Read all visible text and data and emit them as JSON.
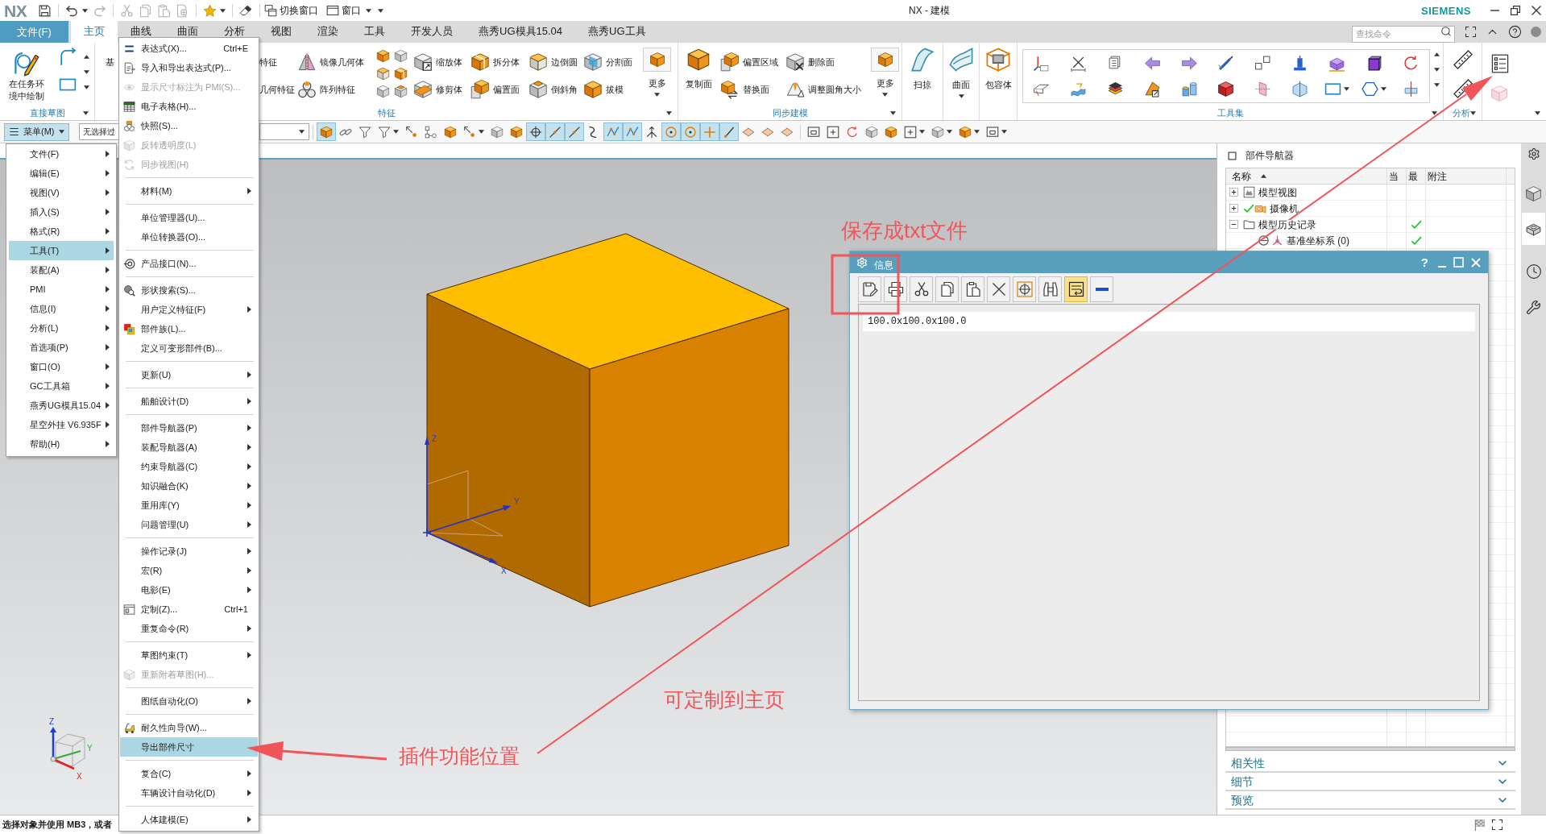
{
  "title_bar": {
    "logo": "NX",
    "quick_access": [
      [
        {
          "kind": "save",
          "disabled": false,
          "dropdown": false
        }
      ],
      [
        {
          "kind": "undo",
          "disabled": false,
          "dropdown": true
        },
        {
          "kind": "redo",
          "disabled": true,
          "dropdown": false
        }
      ],
      [
        {
          "kind": "cut",
          "disabled": true,
          "dropdown": false
        },
        {
          "kind": "copy",
          "disabled": true,
          "dropdown": false
        },
        {
          "kind": "paste",
          "disabled": true,
          "dropdown": false
        },
        {
          "kind": "document",
          "disabled": true,
          "dropdown": false
        }
      ],
      [
        {
          "kind": "star",
          "disabled": false,
          "dropdown": true
        }
      ],
      [
        {
          "kind": "eraser",
          "disabled": false,
          "dropdown": false
        }
      ]
    ],
    "switch_window": "切换窗口",
    "window_menu": "窗口",
    "title": "NX - 建模",
    "brand": "SIEMENS"
  },
  "ribbon_tabs": {
    "file": "文件(F)",
    "tabs": [
      {
        "label": "主页",
        "selected": true
      },
      {
        "label": "曲线",
        "selected": false
      },
      {
        "label": "曲面",
        "selected": false
      },
      {
        "label": "分析",
        "selected": false
      },
      {
        "label": "视图",
        "selected": false
      },
      {
        "label": "渲染",
        "selected": false
      },
      {
        "label": "工具",
        "selected": false
      },
      {
        "label": "开发人员",
        "selected": false
      },
      {
        "label": "燕秀UG模具15.04",
        "selected": false
      },
      {
        "label": "燕秀UG工具",
        "selected": false
      }
    ],
    "search": {
      "placeholder": "查找命令"
    }
  },
  "ribbon": {
    "sketch": {
      "label": "直接草图",
      "button": "在任务环境中绘制"
    },
    "features": {
      "label": "特征",
      "hidden_left": "基",
      "cut_labels": [
        "特征",
        "几何特征"
      ],
      "columns": [
        [
          {
            "label": "镜像几何体",
            "kind": "mirror"
          },
          {
            "label": "阵列特征",
            "kind": "pattern"
          }
        ],
        [
          {
            "label": "缩放体",
            "kind": "scale"
          },
          {
            "label": "修剪体",
            "kind": "trim"
          }
        ],
        [
          {
            "label": "拆分体",
            "kind": "split"
          },
          {
            "label": "偏置面",
            "kind": "offset"
          }
        ],
        [
          {
            "label": "边倒圆",
            "kind": "blend"
          },
          {
            "label": "倒斜角",
            "kind": "chamfer"
          }
        ],
        [
          {
            "label": "分割面",
            "kind": "divide"
          },
          {
            "label": "拔模",
            "kind": "draft"
          }
        ]
      ],
      "more": "更多"
    },
    "sync": {
      "label": "同步建模",
      "large": "复制面",
      "columns": [
        [
          {
            "label": "偏置区域",
            "kind": "offset_region"
          },
          {
            "label": "替换面",
            "kind": "replace"
          }
        ],
        [
          {
            "label": "删除面",
            "kind": "delete_face"
          },
          {
            "label": "调整圆角大小",
            "kind": "resize"
          }
        ]
      ],
      "more": "更多"
    },
    "large_buttons": [
      {
        "label": "扫掠",
        "kind": "sweep",
        "dropdown": false
      },
      {
        "label": "曲面",
        "kind": "surface",
        "dropdown": true
      },
      {
        "label": "包容体",
        "kind": "envelope",
        "dropdown": false
      }
    ],
    "toolset": {
      "label": "工具集"
    },
    "analysis": {
      "label": "分析"
    }
  },
  "toolbar": {
    "menu_button": {
      "label": "菜单(M)",
      "open": true
    },
    "filter": {
      "value": "无选择过"
    },
    "tools": [
      [
        {
          "kind": "body",
          "selected": true,
          "dropdown": false
        },
        {
          "kind": "link",
          "selected": false,
          "dropdown": false
        },
        {
          "kind": "funnel",
          "selected": false,
          "dropdown": false
        },
        {
          "kind": "funnel",
          "selected": false,
          "dropdown": true
        },
        {
          "kind": "point",
          "selected": false,
          "dropdown": false
        },
        {
          "kind": "nodes",
          "selected": false,
          "dropdown": false
        },
        {
          "kind": "body",
          "selected": false,
          "dropdown": false
        },
        {
          "kind": "point",
          "selected": false,
          "dropdown": true
        },
        {
          "kind": "shade",
          "selected": false,
          "dropdown": false
        },
        {
          "kind": "body",
          "selected": false,
          "dropdown": false
        },
        {
          "kind": "target",
          "selected": true,
          "dropdown": false
        },
        {
          "kind": "line",
          "selected": true,
          "dropdown": false
        },
        {
          "kind": "line",
          "selected": true,
          "dropdown": false
        },
        {
          "kind": "curve",
          "selected": false,
          "dropdown": false
        },
        {
          "kind": "polyline",
          "selected": true,
          "dropdown": false
        },
        {
          "kind": "polyline",
          "selected": true,
          "dropdown": false
        },
        {
          "kind": "axis",
          "selected": false,
          "dropdown": false
        },
        {
          "kind": "ring",
          "selected": true,
          "dropdown": false
        },
        {
          "kind": "ring",
          "selected": true,
          "dropdown": false
        },
        {
          "kind": "plus",
          "selected": true,
          "dropdown": false
        },
        {
          "kind": "pen",
          "selected": true,
          "dropdown": false
        },
        {
          "kind": "face",
          "selected": false,
          "dropdown": false
        },
        {
          "kind": "face",
          "selected": false,
          "dropdown": false
        },
        {
          "kind": "face",
          "selected": false,
          "dropdown": false
        }
      ],
      [
        {
          "kind": "frame",
          "selected": false,
          "dropdown": false
        },
        {
          "kind": "fit",
          "selected": false,
          "dropdown": false
        },
        {
          "kind": "rotate",
          "selected": false,
          "dropdown": false
        },
        {
          "kind": "shade",
          "selected": false,
          "dropdown": false
        },
        {
          "kind": "body",
          "selected": false,
          "dropdown": false
        },
        {
          "kind": "fit",
          "selected": false,
          "dropdown": true
        },
        {
          "kind": "shade",
          "selected": false,
          "dropdown": true
        },
        {
          "kind": "body",
          "selected": false,
          "dropdown": true
        },
        {
          "kind": "frame",
          "selected": false,
          "dropdown": true
        }
      ]
    ]
  },
  "main_menu": [
    {
      "label": "文件(F)",
      "selected": false,
      "submenu": true
    },
    {
      "label": "编辑(E)",
      "selected": false,
      "submenu": true
    },
    {
      "label": "视图(V)",
      "selected": false,
      "submenu": true
    },
    {
      "label": "插入(S)",
      "selected": false,
      "submenu": true
    },
    {
      "label": "格式(R)",
      "selected": false,
      "submenu": true
    },
    {
      "label": "工具(T)",
      "selected": true,
      "submenu": true
    },
    {
      "label": "装配(A)",
      "selected": false,
      "submenu": true
    },
    {
      "label": "PMI",
      "selected": false,
      "submenu": true
    },
    {
      "label": "信息(I)",
      "selected": false,
      "submenu": true
    },
    {
      "label": "分析(L)",
      "selected": false,
      "submenu": true
    },
    {
      "label": "首选项(P)",
      "selected": false,
      "submenu": true
    },
    {
      "label": "窗口(O)",
      "selected": false,
      "submenu": true
    },
    {
      "label": "GC工具箱",
      "selected": false,
      "submenu": true
    },
    {
      "label": "燕秀UG模具15.04",
      "selected": false,
      "submenu": true
    },
    {
      "label": "星空外挂 V6.935F",
      "selected": false,
      "submenu": true
    },
    {
      "label": "帮助(H)",
      "selected": false,
      "submenu": true
    }
  ],
  "tools_menu": {
    "sections": [
      [
        {
          "label": "表达式(X)...",
          "shortcut": "Ctrl+E",
          "kind": "formula",
          "disabled": false,
          "selected": false,
          "submenu": false
        },
        {
          "label": "导入和导出表达式(P)...",
          "kind": "import",
          "disabled": false,
          "selected": false,
          "submenu": false
        },
        {
          "label": "显示尺寸标注为 PMI(S)...",
          "kind": "pmi",
          "disabled": true,
          "selected": false,
          "submenu": false
        },
        {
          "label": "电子表格(H)...",
          "kind": "sheet",
          "disabled": false,
          "selected": false,
          "submenu": false
        },
        {
          "label": "快照(S)...",
          "kind": "snapshot",
          "disabled": false,
          "selected": false,
          "submenu": false
        },
        {
          "label": "反转透明度(L)",
          "kind": "transparency",
          "disabled": true,
          "selected": false,
          "submenu": false
        },
        {
          "label": "同步视图(H)",
          "kind": "sync",
          "disabled": true,
          "selected": false,
          "submenu": false
        }
      ],
      [
        {
          "label": "材料(M)",
          "kind": "plain",
          "disabled": false,
          "selected": false,
          "submenu": true
        }
      ],
      [
        {
          "label": "单位管理器(U)...",
          "kind": "plain",
          "disabled": false,
          "selected": false,
          "submenu": false
        },
        {
          "label": "单位转换器(O)...",
          "kind": "plain",
          "disabled": false,
          "selected": false,
          "submenu": false
        }
      ],
      [
        {
          "label": "产品接口(N)...",
          "kind": "interface",
          "disabled": false,
          "selected": false,
          "submenu": false
        }
      ],
      [
        {
          "label": "形状搜索(S)...",
          "kind": "shape",
          "disabled": false,
          "selected": false,
          "submenu": false
        },
        {
          "label": "用户定义特征(F)",
          "kind": "plain",
          "disabled": false,
          "selected": false,
          "submenu": true
        },
        {
          "label": "部件族(L)...",
          "kind": "family",
          "disabled": false,
          "selected": false,
          "submenu": false
        },
        {
          "label": "定义可变形部件(B)...",
          "kind": "plain",
          "disabled": false,
          "selected": false,
          "submenu": false
        }
      ],
      [
        {
          "label": "更新(U)",
          "kind": "plain",
          "disabled": false,
          "selected": false,
          "submenu": true
        }
      ],
      [
        {
          "label": "船舶设计(D)",
          "kind": "plain",
          "disabled": false,
          "selected": false,
          "submenu": true
        }
      ],
      [
        {
          "label": "部件导航器(P)",
          "kind": "plain",
          "disabled": false,
          "selected": false,
          "submenu": true
        },
        {
          "label": "装配导航器(A)",
          "kind": "plain",
          "disabled": false,
          "selected": false,
          "submenu": true
        },
        {
          "label": "约束导航器(C)",
          "kind": "plain",
          "disabled": false,
          "selected": false,
          "submenu": true
        },
        {
          "label": "知识融合(K)",
          "kind": "plain",
          "disabled": false,
          "selected": false,
          "submenu": true
        },
        {
          "label": "重用库(Y)",
          "kind": "plain",
          "disabled": false,
          "selected": false,
          "submenu": true
        },
        {
          "label": "问题管理(U)",
          "kind": "plain",
          "disabled": false,
          "selected": false,
          "submenu": true
        }
      ],
      [
        {
          "label": "操作记录(J)",
          "kind": "plain",
          "disabled": false,
          "selected": false,
          "submenu": true
        },
        {
          "label": "宏(R)",
          "kind": "plain",
          "disabled": false,
          "selected": false,
          "submenu": true
        },
        {
          "label": "电影(E)",
          "kind": "plain",
          "disabled": false,
          "selected": false,
          "submenu": true
        },
        {
          "label": "定制(Z)...",
          "shortcut": "Ctrl+1",
          "kind": "customize",
          "disabled": false,
          "selected": false,
          "submenu": false
        },
        {
          "label": "重复命令(R)",
          "kind": "plain",
          "disabled": false,
          "selected": false,
          "submenu": true
        }
      ],
      [
        {
          "label": "草图约束(T)",
          "kind": "plain",
          "disabled": false,
          "selected": false,
          "submenu": true
        },
        {
          "label": "重新附着草图(H)...",
          "kind": "reattach",
          "disabled": true,
          "selected": false,
          "submenu": false
        }
      ],
      [
        {
          "label": "图纸自动化(O)",
          "kind": "plain",
          "disabled": false,
          "selected": false,
          "submenu": true
        }
      ],
      [
        {
          "label": "耐久性向导(W)...",
          "kind": "durability",
          "disabled": false,
          "selected": false,
          "submenu": false
        },
        {
          "label": "导出部件尺寸",
          "kind": "plain",
          "disabled": false,
          "selected": true,
          "submenu": false
        }
      ],
      [
        {
          "label": "复合(C)",
          "kind": "plain",
          "disabled": false,
          "selected": false,
          "submenu": true
        },
        {
          "label": "车辆设计自动化(D)",
          "kind": "plain",
          "disabled": false,
          "selected": false,
          "submenu": true
        }
      ],
      [
        {
          "label": "人体建模(E)",
          "kind": "plain",
          "disabled": false,
          "selected": false,
          "submenu": true
        }
      ]
    ]
  },
  "viewport": {
    "datum_labels": [
      "Z",
      "Y",
      "X"
    ],
    "triad_labels": [
      "Z",
      "Y",
      "X"
    ]
  },
  "info_dialog": {
    "title": "信息",
    "help": "?",
    "tools": [
      {
        "kind": "save",
        "selected": false
      },
      {
        "kind": "print",
        "selected": false
      },
      {
        "kind": "cut",
        "selected": false
      },
      {
        "kind": "copy",
        "selected": false
      },
      {
        "kind": "paste",
        "selected": false
      },
      {
        "kind": "delete",
        "selected": false
      },
      {
        "kind": "locate",
        "selected": false
      },
      {
        "kind": "find",
        "selected": false
      },
      {
        "kind": "wrap",
        "selected": true
      },
      {
        "kind": "minimize",
        "selected": false
      }
    ],
    "content": "100.0x100.0x100.0"
  },
  "part_navigator": {
    "title": "部件导航器",
    "columns": [
      {
        "label": "名称",
        "sorted": true
      },
      {
        "label": "当",
        "sorted": false
      },
      {
        "label": "最",
        "sorted": false
      },
      {
        "label": "附注",
        "sorted": false
      }
    ],
    "nodes": [
      {
        "label": "模型视图",
        "kind": "views",
        "expanded": false,
        "checked": false,
        "column_3": false
      },
      {
        "label": "摄像机",
        "kind": "camera",
        "expanded": false,
        "checked": true,
        "column_3": false
      },
      {
        "label": "模型历史记录",
        "kind": "folder",
        "expanded": true,
        "checked": false,
        "column_3": true,
        "children": [
          {
            "label": "基准坐标系 (0)",
            "kind": "datum",
            "checked": false,
            "column_3": true
          }
        ]
      }
    ],
    "sections": [
      {
        "label": "相关性",
        "expanded": false
      },
      {
        "label": "细节",
        "expanded": false
      },
      {
        "label": "预览",
        "expanded": false
      }
    ]
  },
  "resource_bar": [
    {
      "kind": "settings",
      "selected": false
    },
    {
      "kind": "assembly",
      "selected": false
    },
    {
      "kind": "part",
      "selected": true
    },
    {
      "kind": "history",
      "selected": false
    },
    {
      "kind": "tools",
      "selected": false
    }
  ],
  "annotations": [
    "保存成txt文件",
    "可定制到主页",
    "插件功能位置"
  ],
  "status_bar": {
    "prompt": "选择对象并使用 MB3，或者"
  }
}
